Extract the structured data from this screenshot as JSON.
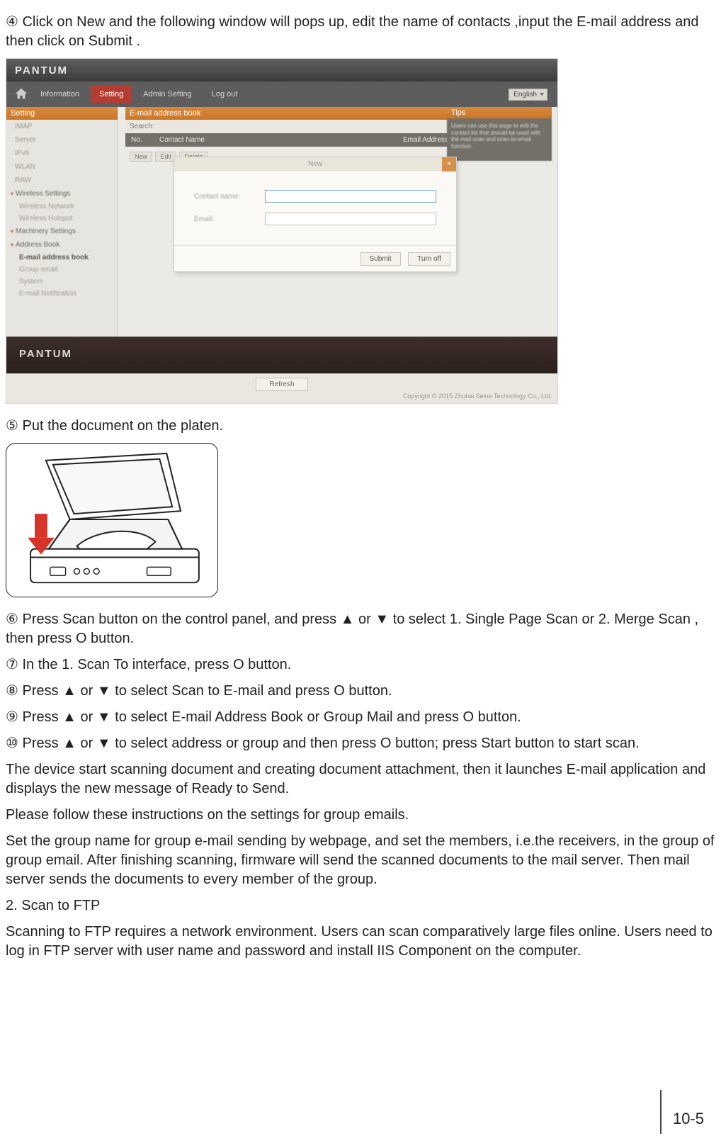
{
  "step4": "④ Click on  New  and the following window will pops up, edit the name of contacts ,input the E-mail address and then click on  Submit .",
  "screenshot": {
    "brand": "PANTUM",
    "nav": {
      "information": "Information",
      "setting": "Setting",
      "admin_setting": "Admin Setting",
      "log_out": "Log out",
      "language": "English"
    },
    "sidebar": {
      "header": "Setting",
      "items": {
        "a": "IMAP",
        "b": "Server",
        "c": "IPv6",
        "d": "WLAN",
        "e": "RAW"
      },
      "wireless": "Wireless Settings",
      "wireless_sub1": "Wireless Network",
      "wireless_sub2": "Wireless Hotspot",
      "machinery": "Machinery Settings",
      "address_book": "Address Book",
      "eab": "E-mail address book",
      "group": "Group email",
      "system": "System",
      "notif": "E-mail Notification"
    },
    "main": {
      "header": "E-mail address book",
      "search_label": "Search:",
      "th_no": "No.",
      "th_name": "Contact Name",
      "th_email": "Email Address",
      "btn_new": "New",
      "btn_edit": "Edit",
      "btn_del": "Delete"
    },
    "tips": {
      "header": "Tips",
      "body": "Users can use this page to edit the contact list that should be used with the mail scan and scan-to-email function."
    },
    "modal": {
      "title": "New",
      "close": "×",
      "contact_label": "Contact name:",
      "email_label": "Email:",
      "submit": "Submit",
      "turn_off": "Turn off"
    },
    "refresh": "Refresh",
    "copyright": "Copyright © 2015 Zhuhai Seine Technology Co., Ltd."
  },
  "step5": "⑤ Put the document on the platen.",
  "step6": "⑥ Press  Scan  button on the control panel, and press  ▲  or  ▼  to select  1. Single Page Scan  or  2. Merge Scan , then press  O     button.",
  "step7": "⑦ In the  1. Scan To  interface, press  O     button.",
  "step8": "⑧ Press  ▲  or  ▼  to select  Scan to E-mail  and press  O     button.",
  "step9": "⑨ Press  ▲  or  ▼  to select  E-mail Address Book  or  Group Mail  and press  O     button.",
  "step10": "⑩ Press  ▲  or  ▼  to select address or group and then press  O     button; press  Start  button to start scan.",
  "para_launch": "The device start scanning document and creating document attachment, then it launches E-mail application and displays the new message of Ready to Send.",
  "para_follow": "Please follow these instructions on the settings for group emails.",
  "para_group": "Set the group name for group e-mail sending by webpage, and set the members, i.e.the receivers, in the group of group email. After finishing scanning, firmware will send the scanned documents to the mail server. Then mail server sends the documents to every member of the group.",
  "h_ftp": "2. Scan to FTP",
  "para_ftp": "Scanning to FTP requires a network environment. Users can scan comparatively large files online. Users need to log in FTP server with user name and password and install IIS Component on the computer.",
  "page_number": "10-5"
}
